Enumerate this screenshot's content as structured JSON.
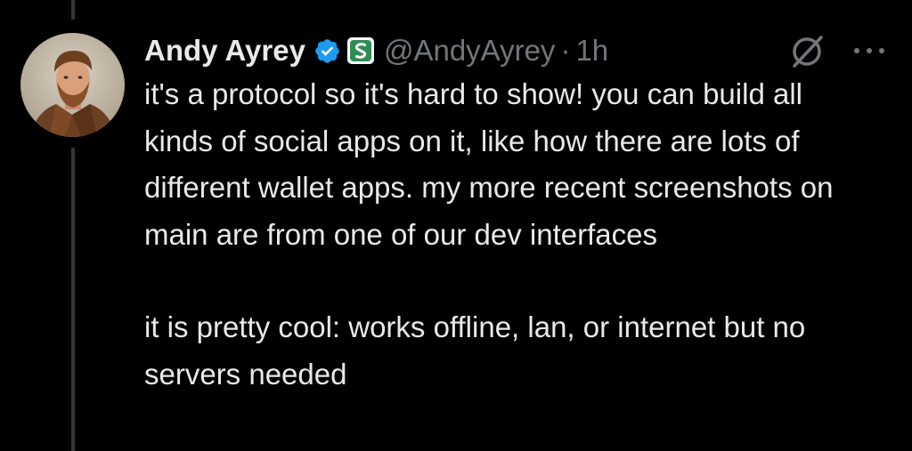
{
  "author": {
    "name": "Andy Ayrey",
    "handle": "@AndyAyrey",
    "separator": "·",
    "time": "1h"
  },
  "icons": {
    "verified": "verified-badge-icon",
    "affiliate": "affiliate-s-badge-icon",
    "grok": "grok-icon",
    "more": "more-options-icon"
  },
  "colors": {
    "background": "#000000",
    "text": "#e7e9ea",
    "muted": "#71767b",
    "verified": "#1d9bf0",
    "thread_line": "#333639"
  },
  "tweet": {
    "paragraphs": [
      "it's a protocol so it's hard to show! you can build all kinds of social apps on it, like how there are lots of different wallet apps. my more recent screenshots on main are from one of our dev interfaces",
      "it is pretty cool: works offline, lan, or internet but no servers needed"
    ]
  }
}
